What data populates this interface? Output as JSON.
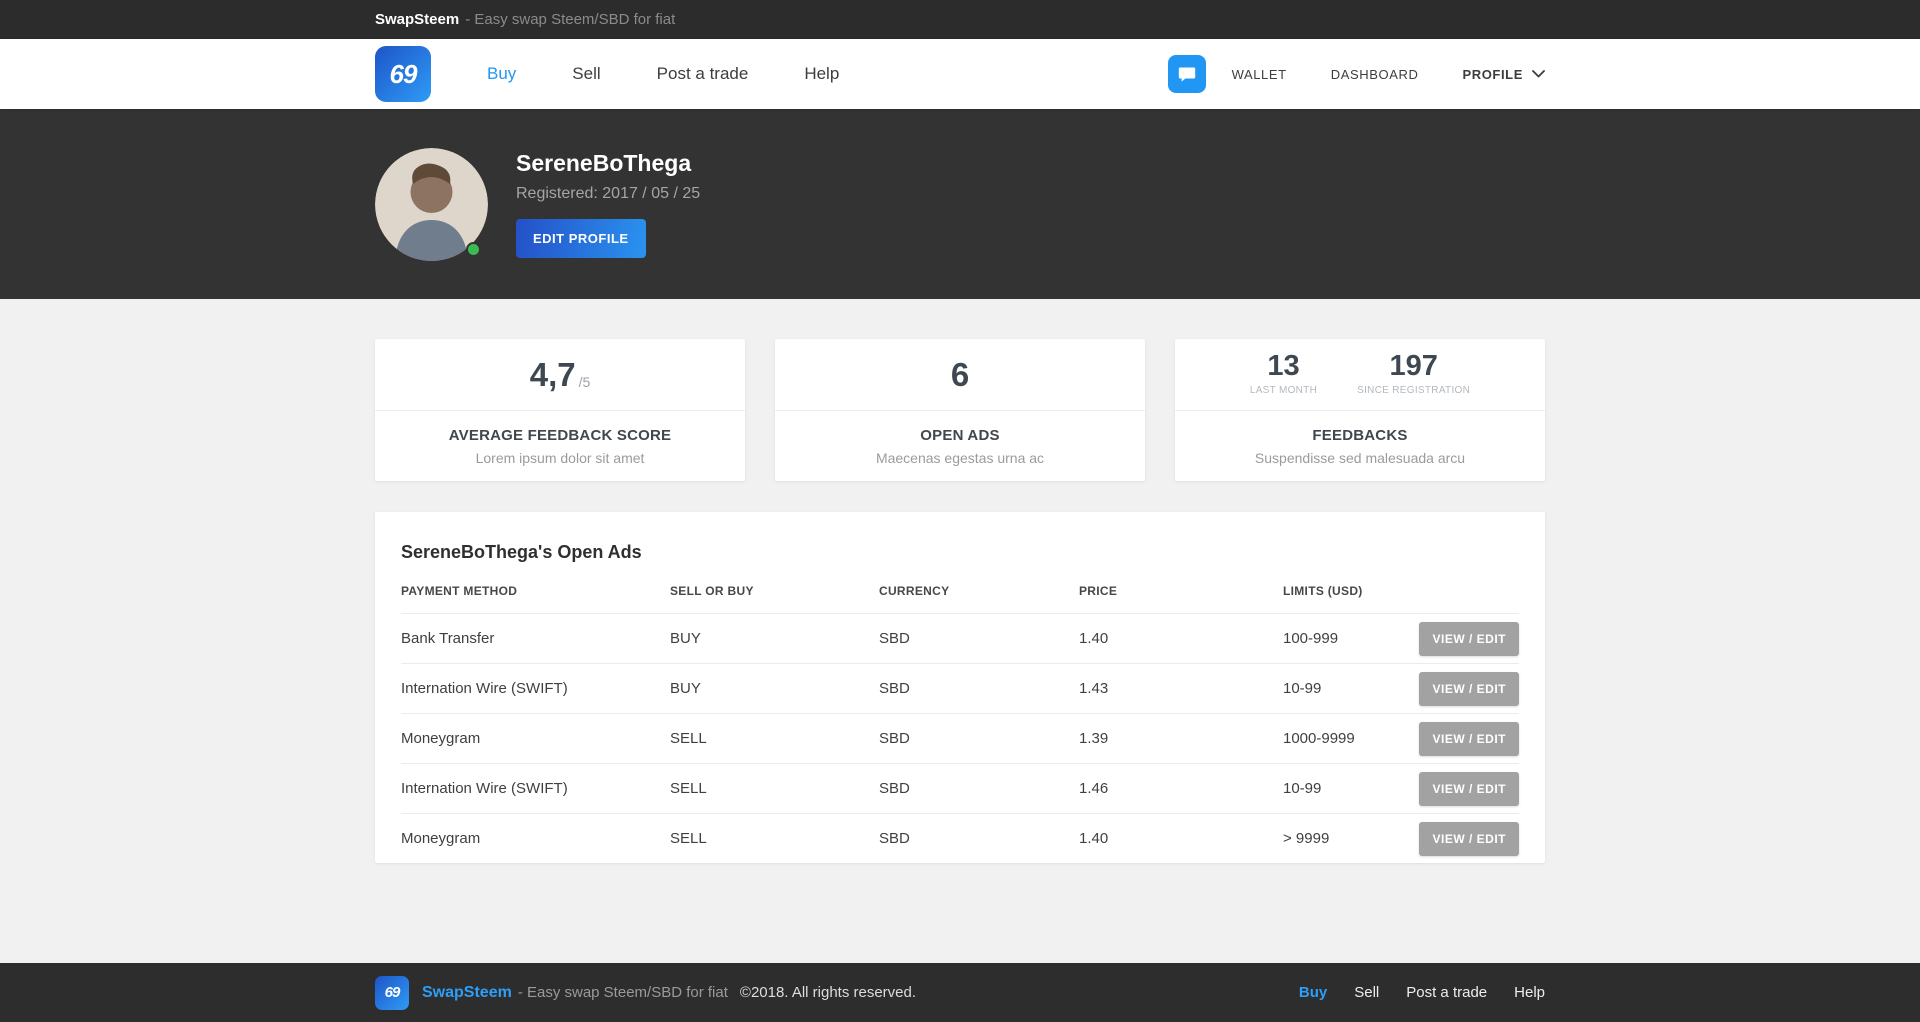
{
  "topbar": {
    "brand": "SwapSteem",
    "tagline": "- Easy swap Steem/SBD for fiat"
  },
  "nav": {
    "links": [
      {
        "label": "Buy",
        "active": true
      },
      {
        "label": "Sell",
        "active": false
      },
      {
        "label": "Post a trade",
        "active": false
      },
      {
        "label": "Help",
        "active": false
      }
    ],
    "right": {
      "wallet": "WALLET",
      "dashboard": "DASHBOARD",
      "profile": "PROFILE"
    }
  },
  "hero": {
    "username": "SereneBoThega",
    "registered": "Registered: 2017 / 05 / 25",
    "edit_button": "EDIT PROFILE"
  },
  "stats": {
    "feedback_score": {
      "value": "4,7",
      "denominator": "/5",
      "title": "AVERAGE FEEDBACK SCORE",
      "subtitle": "Lorem ipsum dolor sit amet"
    },
    "open_ads": {
      "value": "6",
      "title": "OPEN ADS",
      "subtitle": "Maecenas egestas urna ac"
    },
    "feedbacks": {
      "last_month_value": "13",
      "last_month_label": "LAST MONTH",
      "since_value": "197",
      "since_label": "SINCE REGISTRATION",
      "title": "FEEDBACKS",
      "subtitle": "Suspendisse sed malesuada arcu"
    }
  },
  "ads_table": {
    "title": "SereneBoThega's Open Ads",
    "columns": [
      "PAYMENT METHOD",
      "SELL OR BUY",
      "CURRENCY",
      "PRICE",
      "LIMITS (USD)"
    ],
    "action_label": "VIEW / EDIT",
    "rows": [
      {
        "payment_method": "Bank Transfer",
        "side": "BUY",
        "currency": "SBD",
        "price": "1.40",
        "limits": "100-999"
      },
      {
        "payment_method": "Internation Wire (SWIFT)",
        "side": "BUY",
        "currency": "SBD",
        "price": "1.43",
        "limits": "10-99"
      },
      {
        "payment_method": "Moneygram",
        "side": "SELL",
        "currency": "SBD",
        "price": "1.39",
        "limits": "1000-9999"
      },
      {
        "payment_method": "Internation Wire (SWIFT)",
        "side": "SELL",
        "currency": "SBD",
        "price": "1.46",
        "limits": "10-99"
      },
      {
        "payment_method": "Moneygram",
        "side": "SELL",
        "currency": "SBD",
        "price": "1.40",
        "limits": "> 9999"
      }
    ]
  },
  "footer": {
    "brand": "SwapSteem",
    "tagline": "- Easy swap Steem/SBD for fiat",
    "copyright": "©2018. All rights reserved.",
    "links": [
      {
        "label": "Buy",
        "active": true
      },
      {
        "label": "Sell",
        "active": false
      },
      {
        "label": "Post a trade",
        "active": false
      },
      {
        "label": "Help",
        "active": false
      }
    ]
  },
  "icons": {
    "logo_glyph": "69",
    "chat": "chat-bubble-icon",
    "chevron": "chevron-down-icon"
  },
  "colors": {
    "accent": "#2196f3",
    "dark_bar": "#2c2c2c",
    "hero_bg": "#333333",
    "page_bg": "#f1f1f2",
    "online_green": "#3dba54",
    "view_edit_gray": "#a2a2a2"
  }
}
